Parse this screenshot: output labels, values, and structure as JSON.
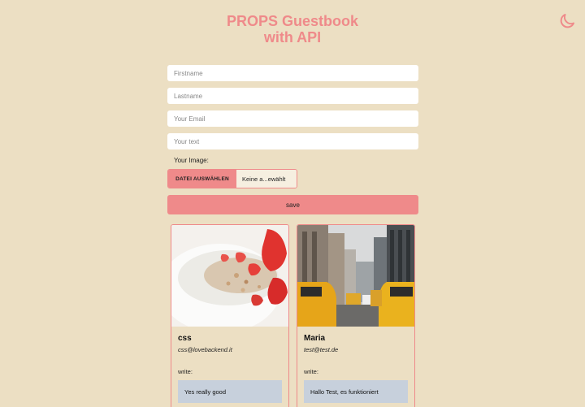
{
  "header": {
    "title_line1": "PROPS Guestbook",
    "title_line2": "with API",
    "theme_icon": "moon-icon"
  },
  "form": {
    "firstname_placeholder": "Firstname",
    "lastname_placeholder": "Lastname",
    "email_placeholder": "Your Email",
    "text_placeholder": "Your text",
    "image_label": "Your Image:",
    "file_button_label": "DATEI AUSWÄHLEN",
    "file_name": "Keine a...ewählt",
    "save_label": "save"
  },
  "entries": [
    {
      "name": "css",
      "email": "css@lovebackend.it",
      "write_label": "write:",
      "message": "Yes really good",
      "image": "yogurt-strawberry-photo"
    },
    {
      "name": "Maria",
      "email": "test@test.de",
      "write_label": "write:",
      "message": "Hallo Test, es funktioniert",
      "image": "city-taxi-photo"
    }
  ],
  "colors": {
    "background": "#ecdfc3",
    "accent": "#ef8a8a",
    "message_bg": "#c7d0dc"
  }
}
